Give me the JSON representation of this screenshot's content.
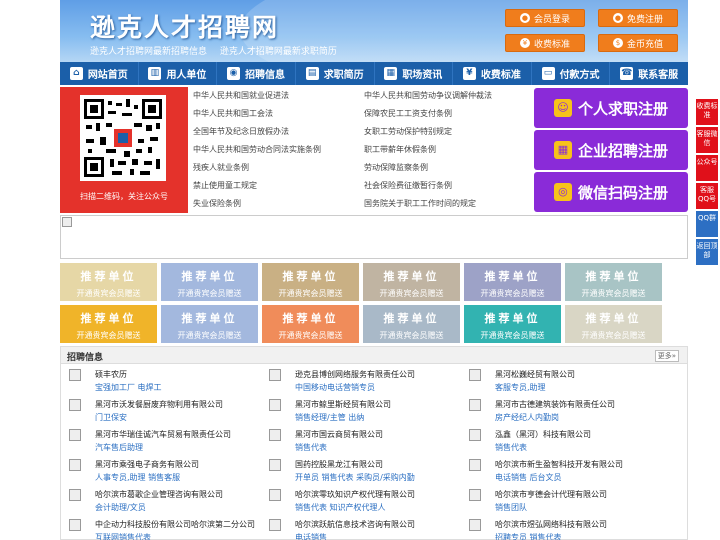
{
  "header": {
    "title": "逊克人才招聘网",
    "subtitle_1": "逊克人才招聘网最新招聘信息",
    "subtitle_2": "逊克人才招聘网最新求职简历",
    "buttons": [
      {
        "label": "会员登录",
        "icon": "user-icon"
      },
      {
        "label": "免费注册",
        "icon": "user-icon"
      },
      {
        "label": "收费标准",
        "icon": "yen-icon"
      },
      {
        "label": "金币充值",
        "icon": "coin-icon"
      }
    ]
  },
  "nav": {
    "items": [
      {
        "label": "网站首页",
        "icon": "home-icon"
      },
      {
        "label": "用人单位",
        "icon": "building-icon"
      },
      {
        "label": "招聘信息",
        "icon": "megaphone-icon"
      },
      {
        "label": "求职简历",
        "icon": "document-icon"
      },
      {
        "label": "职场资讯",
        "icon": "news-icon"
      },
      {
        "label": "收费标准",
        "icon": "yen-icon"
      },
      {
        "label": "付款方式",
        "icon": "wallet-icon"
      },
      {
        "label": "联系客服",
        "icon": "phone-icon"
      }
    ]
  },
  "qr": {
    "caption": "扫描二维码，关注公众号"
  },
  "laws": {
    "left": [
      "中华人民共和国就业促进法",
      "中华人民共和国工会法",
      "全国年节及纪念日放假办法",
      "中华人民共和国劳动合同法实施条例",
      "残疾人就业条例",
      "禁止使用童工规定",
      "失业保险条例"
    ],
    "right": [
      "中华人民共和国劳动争议调解仲裁法",
      "保障农民工工资支付条例",
      "女职工劳动保护特别规定",
      "职工带薪年休假条例",
      "劳动保障监察条例",
      "社会保险费征缴暂行条例",
      "国务院关于职工工作时间的规定"
    ]
  },
  "register": [
    {
      "label": "个人求职注册",
      "icon": "person-icon"
    },
    {
      "label": "企业招聘注册",
      "icon": "company-icon"
    },
    {
      "label": "微信扫码注册",
      "icon": "wechat-icon"
    }
  ],
  "side": [
    "收费标准",
    "客服微信",
    "公众号",
    "客服QQ号",
    "QQ群",
    "返回顶部"
  ],
  "tiles": {
    "title": "推荐单位",
    "subtitle": "开通贵宾会员赠送",
    "colors": [
      "#e6d7a6",
      "#a3b8de",
      "#c9b084",
      "#c0b4a2",
      "#9da2c7",
      "#a8c4c5",
      "#f0b429",
      "#a3b8de",
      "#f08c5a",
      "#a9b9c8",
      "#32b3b1",
      "#d9d6c5"
    ]
  },
  "jobs": {
    "title": "招聘信息",
    "more": "更多»",
    "items": [
      {
        "company": "硕丰农历",
        "positions": "宝强加工厂 电焊工"
      },
      {
        "company": "逊克县博创网络服务有限责任公司",
        "positions": "中国移动电话营销专员"
      },
      {
        "company": "黑河松巍经贸有限公司",
        "positions": "客服专员,助理"
      },
      {
        "company": "黑河市沃发餐厨废弃物利用有限公司",
        "positions": "门卫保安"
      },
      {
        "company": "黑河市鲸里斯经贸有限公司",
        "positions": "销售经理/主管 出纳"
      },
      {
        "company": "黑河市古德建筑装饰有限责任公司",
        "positions": "房产经纪人内勤岗"
      },
      {
        "company": "黑河市华瑞佳诚汽车贸易有限责任公司",
        "positions": "汽车售后助理"
      },
      {
        "company": "黑河市国云商贸有限公司",
        "positions": "销售代表"
      },
      {
        "company": "泓鑫（黑河）科技有限公司",
        "positions": "销售代表"
      },
      {
        "company": "黑河市乘强电子商务有限公司",
        "positions": "人事专员,助理 销售客服"
      },
      {
        "company": "国药控股黑龙江有限公司",
        "positions": "开单员 销售代表 采购员/采购内勤"
      },
      {
        "company": "哈尔滨市新生盈智科技开发有限公司",
        "positions": "电话销售 后台文员"
      },
      {
        "company": "哈尔滨市葛歌企业管理咨询有限公司",
        "positions": "会计助理/文员"
      },
      {
        "company": "哈尔滨零玖知识产权代理有限公司",
        "positions": "销售代表 知识产权代理人"
      },
      {
        "company": "哈尔滨市亨德会计代理有限公司",
        "positions": "销售团队"
      },
      {
        "company": "中企动力科技股份有限公司哈尔滨第二分公司",
        "positions": "互联网销售代表"
      },
      {
        "company": "哈尔滨跃航信息技术咨询有限公司",
        "positions": "电话销售"
      },
      {
        "company": "哈尔滨市煜弘网络科技有限公司",
        "positions": "招聘专员 销售代表"
      }
    ]
  }
}
